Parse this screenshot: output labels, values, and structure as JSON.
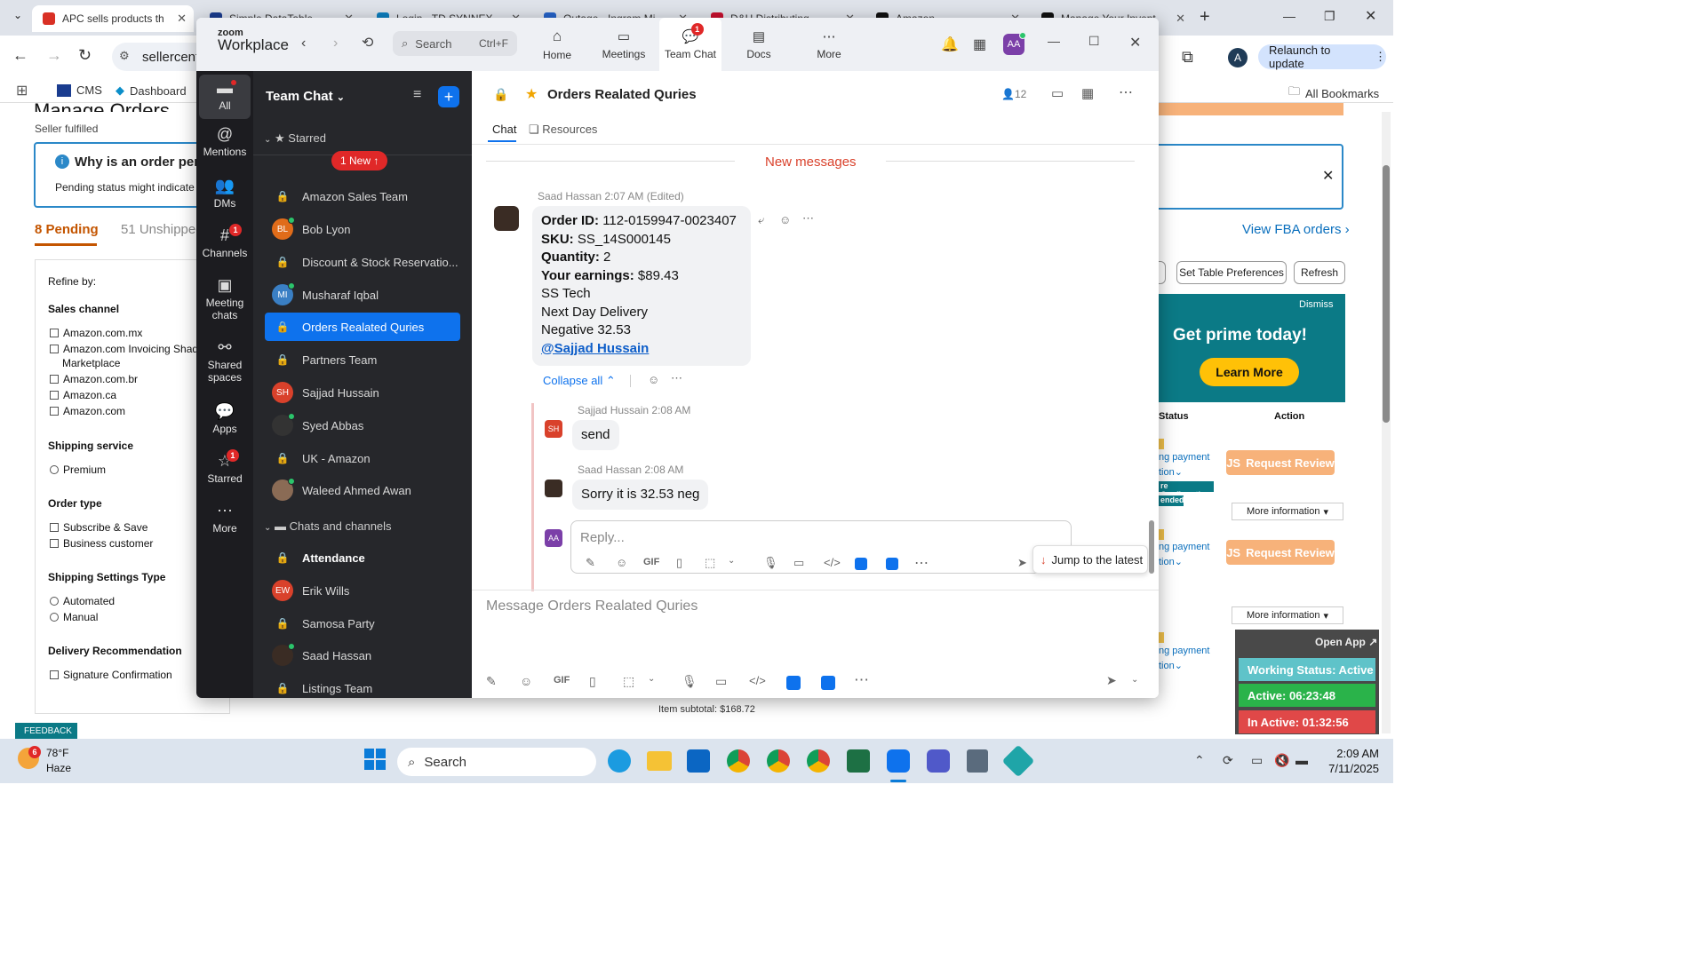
{
  "browser": {
    "tabs": [
      {
        "title": "APC sells products th",
        "color": "#d93025"
      },
      {
        "title": "Simple DataTable",
        "color": "#1a3c8f"
      },
      {
        "title": "Login - TD SYNNEX",
        "color": "#0d7fbf"
      },
      {
        "title": "Outage - Ingram Mi",
        "color": "#2563c9"
      },
      {
        "title": "D&H Distributing",
        "color": "#c8102e"
      },
      {
        "title": "Amazon",
        "color": "#111"
      },
      {
        "title": "Manage Your Invent",
        "color": "#111"
      }
    ],
    "url": "sellercentral.amazon.com",
    "relaunch": "Relaunch to update",
    "profile_initial": "A",
    "bookmarks": [
      {
        "label": "CMS"
      },
      {
        "label": "Dashboard"
      }
    ],
    "all_bookmarks": "All Bookmarks"
  },
  "seller": {
    "page_title": "Manage Orders",
    "subtitle": "Seller fulfilled",
    "notice_title": "Why is an order pen",
    "notice_text": "Pending status might indicate",
    "tab_pending": "8 Pending",
    "tab_unshipped": "51 Unshipped",
    "refine": "Refine by:",
    "sales_channel": "Sales channel",
    "channels": [
      "Amazon.com.mx",
      "Amazon.com Invoicing Shado",
      "Marketplace",
      "Amazon.com.br",
      "Amazon.ca",
      "Amazon.com"
    ],
    "shipping_service": "Shipping service",
    "premium": "Premium",
    "order_type": "Order type",
    "order_types": [
      "Subscribe & Save",
      "Business customer"
    ],
    "settings_type": "Shipping Settings Type",
    "settings": [
      "Automated",
      "Manual"
    ],
    "delivery_rec": "Delivery Recommendation",
    "signature": "Signature Confirmation",
    "view_fba": "View FBA orders",
    "set_table": "Set Table Preferences",
    "refresh": "Refresh",
    "prime_dismiss": "Dismiss",
    "prime_text": "Get prime today!",
    "learn_more": "Learn More",
    "col_status": "Status",
    "col_action": "Action",
    "row_status": "ng payment",
    "row_status2": "tion",
    "confirmation_tag": "re Confirmation",
    "extended_tag": "ended",
    "request_review": "Request Review",
    "more_info": "More information",
    "item_subtotal": "Item subtotal: $168.72",
    "feedback": "FEEDBACK",
    "open_app": "Open App"
  },
  "status_overlay": {
    "working": "Working Status: Active",
    "active": "Active: 06:23:48",
    "inactive": "In Active: 01:32:56"
  },
  "zoom": {
    "logo_top": "zoom",
    "logo_bottom": "Workplace",
    "search_placeholder": "Search",
    "search_shortcut": "Ctrl+F",
    "nav": [
      {
        "label": "Home"
      },
      {
        "label": "Meetings"
      },
      {
        "label": "Team Chat",
        "badge": "1"
      },
      {
        "label": "Docs"
      },
      {
        "label": "More"
      }
    ],
    "avatar_initials": "AA",
    "rail": [
      {
        "label": "All"
      },
      {
        "label": "Mentions"
      },
      {
        "label": "DMs"
      },
      {
        "label": "Channels",
        "badge": "1"
      },
      {
        "label": "Meeting chats"
      },
      {
        "label": "Shared spaces"
      },
      {
        "label": "Apps"
      },
      {
        "label": "Starred",
        "badge": "1"
      },
      {
        "label": "More"
      }
    ],
    "list_title": "Team Chat",
    "starred_label": "Starred",
    "new_pill": "1 New ↑",
    "starred_items": [
      {
        "name": "Amazon Sales Team",
        "type": "lock"
      },
      {
        "name": "Bob Lyon",
        "type": "avatar",
        "initials": "BL",
        "color": "#e06c1a"
      },
      {
        "name": "Discount & Stock Reservatio...",
        "type": "lock"
      },
      {
        "name": "Musharaf Iqbal",
        "type": "avatar",
        "initials": "MI",
        "color": "#3a7fc4"
      },
      {
        "name": "Orders Realated Quries",
        "type": "lock"
      },
      {
        "name": "Partners Team",
        "type": "lock"
      },
      {
        "name": "Sajjad Hussain",
        "type": "avatar",
        "initials": "SH",
        "color": "#d9412b"
      },
      {
        "name": "Syed Abbas",
        "type": "photo"
      },
      {
        "name": "UK - Amazon",
        "type": "lock"
      },
      {
        "name": "Waleed Ahmed Awan",
        "type": "photo"
      }
    ],
    "chats_label": "Chats and channels",
    "chat_items": [
      {
        "name": "Attendance",
        "type": "lock"
      },
      {
        "name": "Erik Wills",
        "type": "avatar",
        "initials": "EW",
        "color": "#d9412b"
      },
      {
        "name": "Samosa Party",
        "type": "lock"
      },
      {
        "name": "Saad Hassan",
        "type": "photo"
      },
      {
        "name": "Listings Team",
        "type": "lock"
      }
    ],
    "channel_title": "Orders Realated Quries",
    "member_count": "12",
    "tab_chat": "Chat",
    "tab_resources": "Resources",
    "new_messages": "New messages",
    "msg1": {
      "sender": "Saad Hassan",
      "time": "2:07 AM (Edited)",
      "order_label": "Order ID:",
      "order_value": "112-0159947-0023407",
      "sku_label": "SKU:",
      "sku_value": "SS_14S000145",
      "qty_label": "Quantity:",
      "qty_value": "2",
      "earn_label": "Your earnings:",
      "earn_value": "$89.43",
      "line5": "SS Tech",
      "line6": "Next Day Delivery",
      "line7": "Negative 32.53",
      "mention": "@Sajjad Hussain"
    },
    "collapse_all": "Collapse all",
    "reply1": {
      "sender": "Sajjad Hussain",
      "time": "2:08 AM",
      "text": "send",
      "initials": "SH"
    },
    "reply2": {
      "sender": "Saad Hassan",
      "time": "2:08 AM",
      "text": "Sorry it is 32.53 neg"
    },
    "reply_placeholder": "Reply...",
    "jump_latest": "Jump to the latest",
    "compose_placeholder": "Message Orders Realated Quries",
    "gif": "GIF"
  },
  "taskbar": {
    "temp": "78°F",
    "weather": "Haze",
    "weather_badge": "6",
    "search": "Search",
    "time": "2:09 AM",
    "date": "7/11/2025"
  }
}
